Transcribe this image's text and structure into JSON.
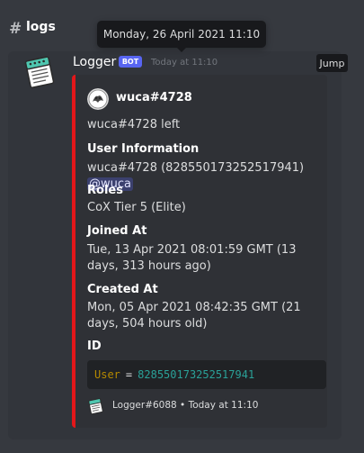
{
  "channel": {
    "hash": "#",
    "name": "logs"
  },
  "tooltip": {
    "text": "Monday, 26 April 2021 11:10"
  },
  "message": {
    "author": "Logger",
    "bot_tag": "BOT",
    "timestamp": "Today at 11:10",
    "jump_label": "Jump"
  },
  "embed": {
    "accent_color": "#e3171a",
    "author_name": "wuca#4728",
    "description": "wuca#4728 left",
    "fields": [
      {
        "name": "User Information",
        "value": "wuca#4728 (828550173252517941)",
        "mention": "@wuca"
      },
      {
        "name": "Roles",
        "value": "CoX Tier 5 (Elite)"
      },
      {
        "name": "Joined At",
        "value": "Tue, 13 Apr 2021 08:01:59 GMT (13 days, 313 hours ago)"
      },
      {
        "name": "Created At",
        "value": "Mon, 05 Apr 2021 08:42:35 GMT (21 days, 504 hours old)"
      },
      {
        "name": "ID"
      }
    ],
    "code": {
      "key": "User",
      "eq": "=",
      "value": "828550173252517941"
    },
    "footer": {
      "text": "Logger#6088 • Today at 11:10"
    }
  },
  "icons": [
    "notepad-icon",
    "user-avatar-icon"
  ]
}
